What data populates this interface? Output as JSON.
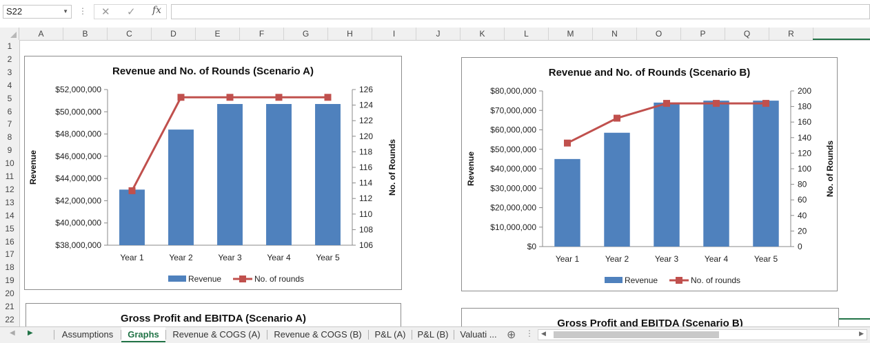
{
  "formula_bar": {
    "name_box": "S22",
    "cancel_icon": "✕",
    "enter_icon": "✓",
    "fx_label": "fx",
    "formula_value": ""
  },
  "columns": [
    "A",
    "B",
    "C",
    "D",
    "E",
    "F",
    "G",
    "H",
    "I",
    "J",
    "K",
    "L",
    "M",
    "N",
    "O",
    "P",
    "Q",
    "R"
  ],
  "rows": [
    "1",
    "2",
    "3",
    "4",
    "5",
    "6",
    "7",
    "8",
    "9",
    "10",
    "11",
    "12",
    "13",
    "14",
    "15",
    "16",
    "17",
    "18",
    "19",
    "20",
    "21",
    "22"
  ],
  "charts": [
    {
      "title": "Revenue and No. of Rounds (Scenario A)",
      "y_label": "Revenue",
      "y2_label": "No. of Rounds",
      "legend": [
        "Revenue",
        "No. of rounds"
      ]
    },
    {
      "title": "Revenue and No. of Rounds (Scenario B)",
      "y_label": "Revenue",
      "y2_label": "No. of Rounds",
      "legend": [
        "Revenue",
        "No. of rounds"
      ]
    },
    {
      "title": "Gross Profit and EBITDA (Scenario A)"
    },
    {
      "title": "Gross Profit and EBITDA (Scenario B)"
    }
  ],
  "chart_data": [
    {
      "type": "bar",
      "title": "Revenue and No. of Rounds (Scenario A)",
      "categories": [
        "Year 1",
        "Year 2",
        "Year 3",
        "Year 4",
        "Year 5"
      ],
      "series": [
        {
          "name": "Revenue",
          "type": "bar",
          "axis": "left",
          "color": "#4f81bd",
          "values": [
            43000000,
            48400000,
            50700000,
            50700000,
            50700000
          ]
        },
        {
          "name": "No. of rounds",
          "type": "line",
          "axis": "right",
          "color": "#c0504d",
          "values": [
            113,
            125,
            125,
            125,
            125
          ]
        }
      ],
      "ylabel": "Revenue",
      "y2label": "No. of Rounds",
      "ylim": [
        38000000,
        52000000
      ],
      "yticks": [
        38000000,
        40000000,
        42000000,
        44000000,
        46000000,
        48000000,
        50000000,
        52000000
      ],
      "ytick_labels": [
        "$38,000,000",
        "$40,000,000",
        "$42,000,000",
        "$44,000,000",
        "$46,000,000",
        "$48,000,000",
        "$50,000,000",
        "$52,000,000"
      ],
      "y2lim": [
        106,
        126
      ],
      "y2ticks": [
        106,
        108,
        110,
        112,
        114,
        116,
        118,
        120,
        122,
        124,
        126
      ],
      "y2tick_labels": [
        "106",
        "108",
        "110",
        "112",
        "114",
        "116",
        "118",
        "120",
        "122",
        "124",
        "126"
      ],
      "legend_position": "bottom",
      "grid": false
    },
    {
      "type": "bar",
      "title": "Revenue and No. of Rounds (Scenario B)",
      "categories": [
        "Year 1",
        "Year 2",
        "Year 3",
        "Year 4",
        "Year 5"
      ],
      "series": [
        {
          "name": "Revenue",
          "type": "bar",
          "axis": "left",
          "color": "#4f81bd",
          "values": [
            45000000,
            58500000,
            74000000,
            75000000,
            75000000
          ]
        },
        {
          "name": "No. of rounds",
          "type": "line",
          "axis": "right",
          "color": "#c0504d",
          "values": [
            133,
            165,
            184,
            184,
            184
          ]
        }
      ],
      "ylabel": "Revenue",
      "y2label": "No. of Rounds",
      "ylim": [
        0,
        80000000
      ],
      "yticks": [
        0,
        10000000,
        20000000,
        30000000,
        40000000,
        50000000,
        60000000,
        70000000,
        80000000
      ],
      "ytick_labels": [
        "$0",
        "$10,000,000",
        "$20,000,000",
        "$30,000,000",
        "$40,000,000",
        "$50,000,000",
        "$60,000,000",
        "$70,000,000",
        "$80,000,000"
      ],
      "y2lim": [
        0,
        200
      ],
      "y2ticks": [
        0,
        20,
        40,
        60,
        80,
        100,
        120,
        140,
        160,
        180,
        200
      ],
      "y2tick_labels": [
        "0",
        "20",
        "40",
        "60",
        "80",
        "100",
        "120",
        "140",
        "160",
        "180",
        "200"
      ],
      "legend_position": "bottom",
      "grid": false
    }
  ],
  "sheet_tabs": {
    "items": [
      "Assumptions",
      "Graphs",
      "Revenue & COGS (A)",
      "Revenue & COGS (B)",
      "P&L (A)",
      "P&L (B)",
      "Valuati ..."
    ],
    "active": "Graphs",
    "add_icon": "⊕"
  }
}
